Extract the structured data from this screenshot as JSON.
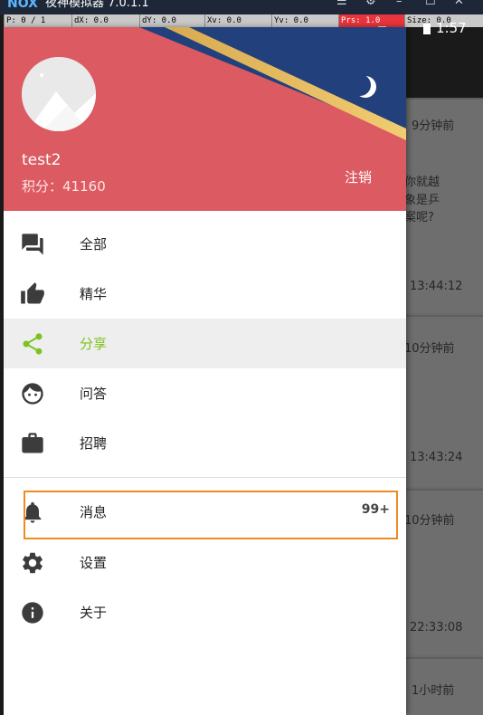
{
  "window": {
    "logo": "NOX",
    "title": "夜神模拟器 7.0.1.1",
    "controls": [
      "☰",
      "⚙",
      "–",
      "☐",
      "✕"
    ]
  },
  "debug_bar": {
    "p": "P: 0 / 1",
    "dx": "dX: 0.0",
    "dy": "dY: 0.0",
    "xv": "Xv: 0.0",
    "yv": "Yv: 0.0",
    "prs": "Prs: 1.0",
    "size": "Size: 0.0"
  },
  "status_bar": {
    "time": "1:57"
  },
  "background_list": {
    "items": [
      {
        "time": "9分钟前",
        "snippet": [
          "你就越",
          "象是乒",
          "案呢?"
        ],
        "date": "13:44:12"
      },
      {
        "time": "10分钟前",
        "date": "13:43:24"
      },
      {
        "time": "10分钟前",
        "date": "22:33:08"
      },
      {
        "time": "1小时前"
      }
    ]
  },
  "drawer": {
    "username": "test2",
    "points_label": "积分：",
    "points_value": "41160",
    "logout_label": "注销",
    "menu": [
      {
        "label": "全部",
        "icon": "forum-icon"
      },
      {
        "label": "精华",
        "icon": "thumb-up-icon"
      },
      {
        "label": "分享",
        "icon": "share-icon",
        "active": true
      },
      {
        "label": "问答",
        "icon": "face-icon"
      },
      {
        "label": "招聘",
        "icon": "briefcase-icon"
      }
    ],
    "secondary": [
      {
        "label": "消息",
        "icon": "bell-icon",
        "count": "99+"
      },
      {
        "label": "设置",
        "icon": "gear-icon"
      },
      {
        "label": "关于",
        "icon": "info-icon"
      }
    ]
  },
  "colors": {
    "header_red": "#dc5a61",
    "header_navy": "#21407c",
    "active_green": "#7cc31d",
    "highlight_orange": "#f08a24",
    "icon_gray": "#3c3c3c"
  }
}
